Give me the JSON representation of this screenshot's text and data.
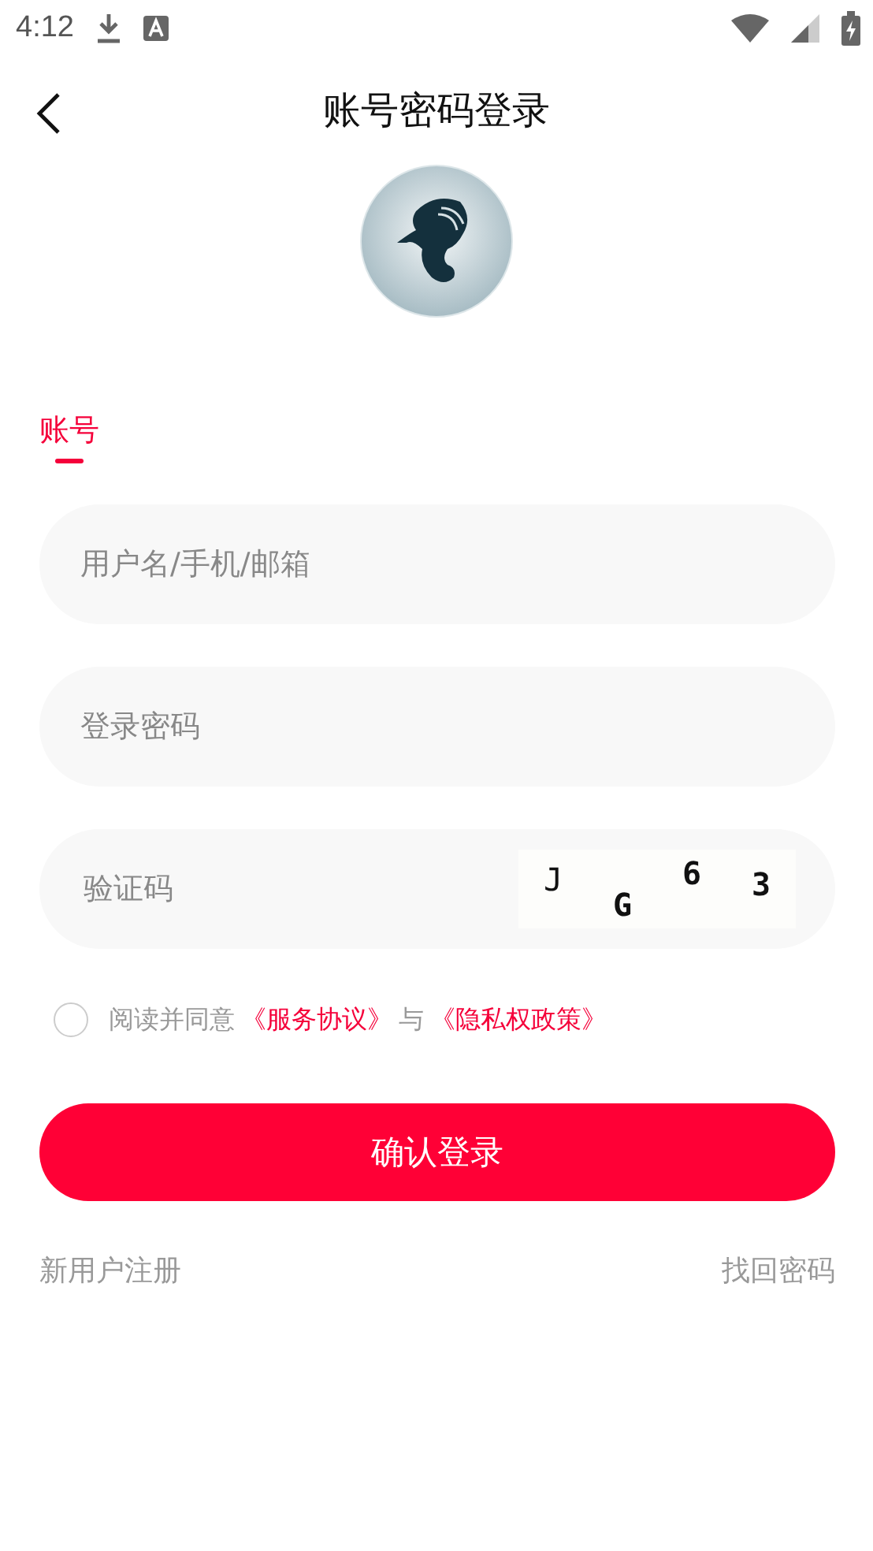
{
  "status_bar": {
    "time": "4:12"
  },
  "header": {
    "title": "账号密码登录"
  },
  "tabs": [
    {
      "label": "账号",
      "selected": true
    }
  ],
  "fields": [
    {
      "kind": "text",
      "placeholder": "用户名/手机/邮箱"
    },
    {
      "kind": "password",
      "placeholder": "登录密码"
    },
    {
      "kind": "captcha",
      "placeholder": "验证码",
      "captcha": [
        "J",
        "G",
        "6",
        "3"
      ]
    }
  ],
  "agreement": {
    "checked": false,
    "parts": [
      {
        "kind": "plain",
        "text": "阅读并同意"
      },
      {
        "kind": "link",
        "text": "《服务协议》"
      },
      {
        "kind": "plain",
        "text": "与"
      },
      {
        "kind": "link",
        "text": "《隐私权政策》"
      }
    ]
  },
  "submit": "确认登录",
  "footer": {
    "register": "新用户注册",
    "recover": "找回密码"
  }
}
